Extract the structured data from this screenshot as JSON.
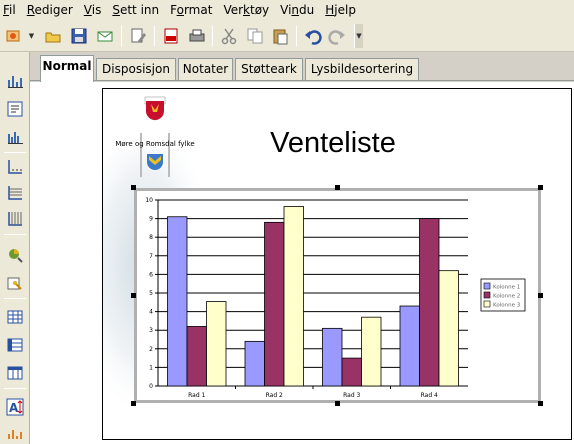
{
  "menu": {
    "items": [
      {
        "label": "Fil",
        "key": "F"
      },
      {
        "label": "Rediger",
        "key": "R"
      },
      {
        "label": "Vis",
        "key": "V"
      },
      {
        "label": "Sett inn",
        "key": "S"
      },
      {
        "label": "Format",
        "key": "o"
      },
      {
        "label": "Verktøy",
        "key": "k"
      },
      {
        "label": "Vindu",
        "key": "n"
      },
      {
        "label": "Hjelp",
        "key": "H"
      }
    ]
  },
  "toolbar": {
    "icons": [
      "new-document-icon",
      "open-folder-icon",
      "save-icon",
      "email-icon",
      "edit-file-icon",
      "export-pdf-icon",
      "print-icon",
      "cut-icon",
      "copy-icon",
      "paste-icon",
      "undo-icon",
      "redo-icon"
    ]
  },
  "left_toolbar": {
    "icons": [
      "chart-type-icon",
      "chart-title-icon",
      "chart-legend-icon",
      "chart-axis-icon",
      "horizontal-grid-icon",
      "vertical-grid-icon",
      "chart-wall-icon",
      "chart-area-icon",
      "data-table-icon",
      "data-rows-icon",
      "data-columns-icon",
      "text-scale-icon",
      "chart-options-icon"
    ]
  },
  "tabs": [
    {
      "label": "Normal",
      "active": true
    },
    {
      "label": "Disposisjon",
      "active": false
    },
    {
      "label": "Notater",
      "active": false
    },
    {
      "label": "Støtteark",
      "active": false
    },
    {
      "label": "Lysbildesortering",
      "active": false
    }
  ],
  "slide": {
    "logo_text": "Møre og Romsdal fylke",
    "title": "Venteliste"
  },
  "chart_data": {
    "type": "bar",
    "categories": [
      "Rad 1",
      "Rad 2",
      "Rad 3",
      "Rad 4"
    ],
    "series": [
      {
        "name": "Kolonne 1",
        "values": [
          9.1,
          2.4,
          3.1,
          4.3
        ],
        "color": "#9999ff"
      },
      {
        "name": "Kolonne 2",
        "values": [
          3.2,
          8.8,
          1.5,
          9.0
        ],
        "color": "#993366"
      },
      {
        "name": "Kolonne 3",
        "values": [
          4.54,
          9.65,
          3.7,
          6.2
        ],
        "color": "#ffffcc"
      }
    ],
    "yticks": [
      "0",
      "1",
      "2",
      "3",
      "4",
      "5",
      "6",
      "7",
      "8",
      "9",
      "10"
    ],
    "ylim": [
      0,
      10
    ],
    "grid": true,
    "legend": "right"
  },
  "colors": {
    "accent": "#316ac5",
    "menu_bg": "#ece9d8"
  }
}
